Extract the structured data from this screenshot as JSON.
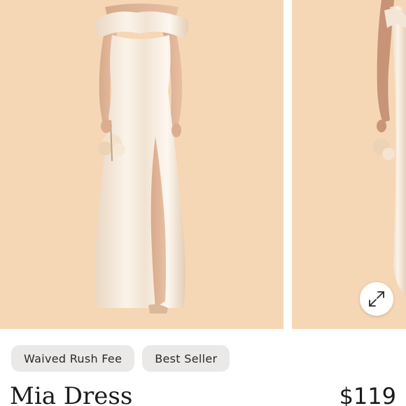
{
  "gallery": {
    "background_color": "#f5d7b6",
    "expand_icon": "expand-arrows-icon"
  },
  "badges": [
    {
      "label": "Waived Rush Fee"
    },
    {
      "label": "Best Seller"
    }
  ],
  "product": {
    "name": "Mia Dress",
    "price": "$119"
  }
}
